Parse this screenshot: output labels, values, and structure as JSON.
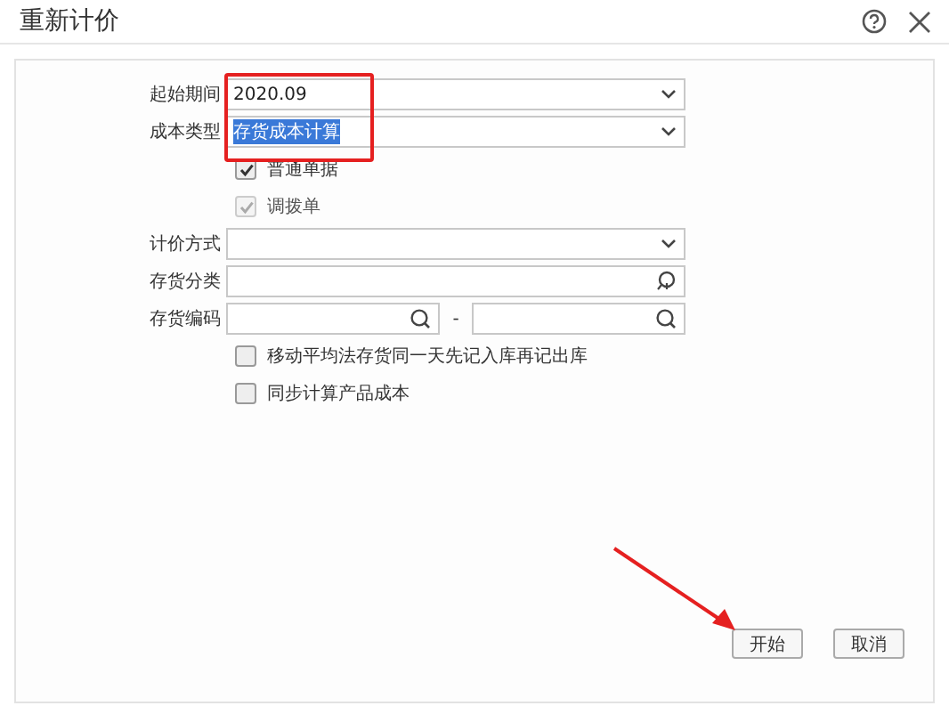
{
  "window": {
    "title": "重新计价"
  },
  "rows": [
    {
      "kind": "select",
      "label": "起始期间",
      "value": "2020.09",
      "highlighted": false
    },
    {
      "kind": "select",
      "label": "成本类型",
      "value": "存货成本计算",
      "highlighted": true
    },
    {
      "kind": "checkbox",
      "label": "普通单据",
      "checked": true,
      "disabled": false
    },
    {
      "kind": "checkbox",
      "label": "调拨单",
      "checked": true,
      "disabled": true
    },
    {
      "kind": "select",
      "label": "计价方式"
    },
    {
      "kind": "lookup",
      "label": "存货分类"
    },
    {
      "kind": "range",
      "label": "存货编码",
      "separator": "-"
    },
    {
      "kind": "checkbox",
      "label": "移动平均法存货同一天先记入库再记出库",
      "checked": false,
      "disabled": false
    },
    {
      "kind": "checkbox",
      "label": "同步计算产品成本",
      "checked": false,
      "disabled": false
    }
  ],
  "buttons": [
    "开始",
    "取消"
  ]
}
